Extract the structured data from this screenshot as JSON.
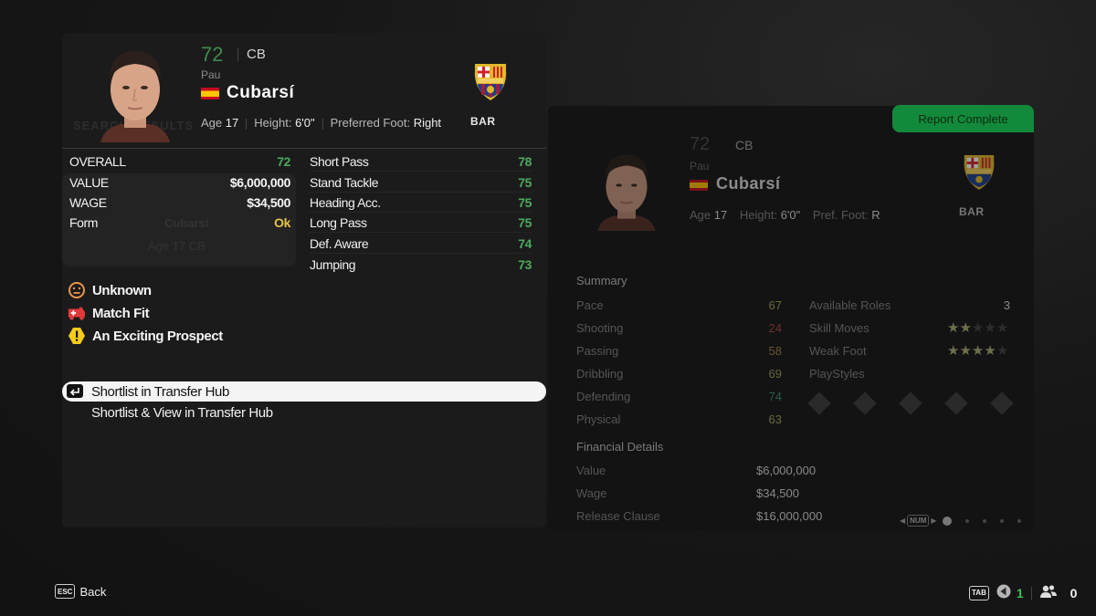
{
  "player": {
    "rating": "72",
    "position": "CB",
    "first_name": "Pau",
    "last_name": "Cubarsí",
    "nationality_flag": "spain-flag",
    "age_label": "Age",
    "age": "17",
    "height_label": "Height:",
    "height": "6'0\"",
    "foot_label": "Preferred Foot:",
    "foot": "Right",
    "club_abbr": "BAR",
    "club_crest": "fc-barcelona-crest-icon"
  },
  "background_ghost": {
    "search_label": "SEARCH RESULTS",
    "ghost_name": "Cubarsí",
    "ghost_meta": "Age 17   CB"
  },
  "overview": [
    {
      "label": "OVERALL",
      "value": "72",
      "color": "#4caa5c"
    },
    {
      "label": "VALUE",
      "value": "$6,000,000",
      "color": "#f5f5f5"
    },
    {
      "label": "WAGE",
      "value": "$34,500",
      "color": "#f5f5f5"
    },
    {
      "label": "Form",
      "value": "Ok",
      "color": "#e8c547"
    }
  ],
  "key_stats": [
    {
      "label": "Short Pass",
      "value": "78"
    },
    {
      "label": "Stand Tackle",
      "value": "75"
    },
    {
      "label": "Heading Acc.",
      "value": "75"
    },
    {
      "label": "Long Pass",
      "value": "75"
    },
    {
      "label": "Def. Aware",
      "value": "74"
    },
    {
      "label": "Jumping",
      "value": "73"
    }
  ],
  "statuses": [
    {
      "icon": "neutral-face-icon",
      "label": "Unknown"
    },
    {
      "icon": "ambulance-icon",
      "label": "Match Fit"
    },
    {
      "icon": "warning-hexagon-icon",
      "label": "An Exciting Prospect"
    }
  ],
  "actions": [
    {
      "label": "Shortlist in Transfer Hub",
      "selected": true,
      "key_icon": "enter-key-icon"
    },
    {
      "label": "Shortlist & View in Transfer Hub",
      "selected": false
    }
  ],
  "report": {
    "badge": "Report Complete",
    "badge_color": "#138a3b",
    "rating": "72",
    "position": "CB",
    "first_name": "Pau",
    "last_name": "Cubarsí",
    "age_label": "Age",
    "age": "17",
    "height_label": "Height:",
    "height": "6'0\"",
    "foot_label": "Pref. Foot:",
    "foot": "R",
    "club_abbr": "BAR",
    "summary_title": "Summary",
    "summary": [
      {
        "label": "Pace",
        "value": "67",
        "color": "#6c6a3c"
      },
      {
        "label": "Shooting",
        "value": "24",
        "color": "#6b3230"
      },
      {
        "label": "Passing",
        "value": "58",
        "color": "#6b5530"
      },
      {
        "label": "Dribbling",
        "value": "69",
        "color": "#676738"
      },
      {
        "label": "Defending",
        "value": "74",
        "color": "#2f5a45"
      },
      {
        "label": "Physical",
        "value": "63",
        "color": "#6c6a3c"
      }
    ],
    "available_roles_label": "Available Roles",
    "available_roles": "3",
    "skill_moves_label": "Skill Moves",
    "skill_moves_stars": 2,
    "weak_foot_label": "Weak Foot",
    "weak_foot_stars": 4,
    "stars_max": 5,
    "playstyles_label": "PlayStyles",
    "playstyle_slots": 5,
    "financial_title": "Financial Details",
    "financial": [
      {
        "label": "Value",
        "value": "$6,000,000"
      },
      {
        "label": "Wage",
        "value": "$34,500"
      },
      {
        "label": "Release Clause",
        "value": "$16,000,000"
      }
    ],
    "pager": {
      "key": "NUM",
      "pages": 5,
      "current": 1
    }
  },
  "footer": {
    "back_key": "ESC",
    "back_label": "Back",
    "tab_key": "TAB",
    "scouts_count": "1",
    "players_count": "0",
    "scouts_count_color": "#3fbf5f"
  }
}
